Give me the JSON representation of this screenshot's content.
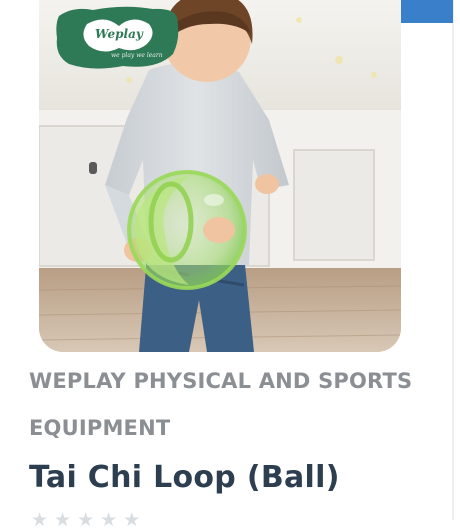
{
  "brand": {
    "logo_name": "Weplay",
    "logo_tagline": "we play we learn"
  },
  "top_button": {
    "color": "#3a7fc9"
  },
  "product": {
    "category": "WEPLAY PHYSICAL AND SPORTS EQUIPMENT",
    "title": "Tai Chi Loop (Ball)",
    "rating": 0,
    "rating_max": 5
  },
  "colors": {
    "category_text": "#8b8f93",
    "title_text": "#2c3e4f",
    "star_empty": "#d9dde0",
    "logo_green": "#2f7a56"
  }
}
